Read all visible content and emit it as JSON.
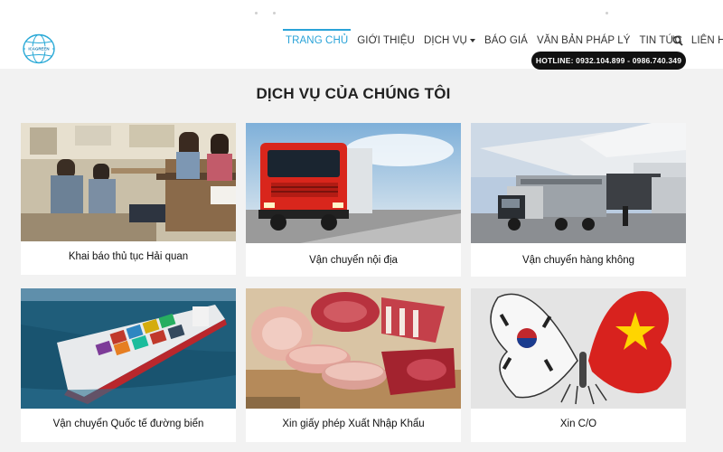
{
  "brand": {
    "logo_text": "ICAGREEN"
  },
  "nav": {
    "items": [
      {
        "label": "TRANG CHỦ",
        "active": true
      },
      {
        "label": "GIỚI THIỆU"
      },
      {
        "label": "DỊCH VỤ",
        "dropdown": true
      },
      {
        "label": "BÁO GIÁ"
      },
      {
        "label": "VĂN BẢN PHÁP LÝ"
      },
      {
        "label": "TIN TỨC"
      },
      {
        "label": "LIÊN HỆ"
      }
    ],
    "search_icon": "search-icon"
  },
  "hotline": "HOTLINE: 0932.104.899 - 0986.740.349",
  "section": {
    "title": "DỊCH VỤ CỦA CHÚNG TÔI"
  },
  "services": [
    {
      "caption": "Khai báo thủ tục Hải quan",
      "image": "customs-office-photo"
    },
    {
      "caption": "Vận chuyển nội địa",
      "image": "red-truck-photo"
    },
    {
      "caption": "Vận chuyển hàng không",
      "image": "cargo-plane-photo"
    },
    {
      "caption": "Vận chuyển Quốc tế đường biển",
      "image": "container-ship-photo"
    },
    {
      "caption": "Xin giấy phép Xuất Nhập Khẩu",
      "image": "meat-photo"
    },
    {
      "caption": "Xin C/O",
      "image": "flag-butterfly-photo"
    }
  ],
  "colors": {
    "accent": "#2aa3d8",
    "hotline_bg": "#111111",
    "page_bg": "#f2f2f2"
  }
}
